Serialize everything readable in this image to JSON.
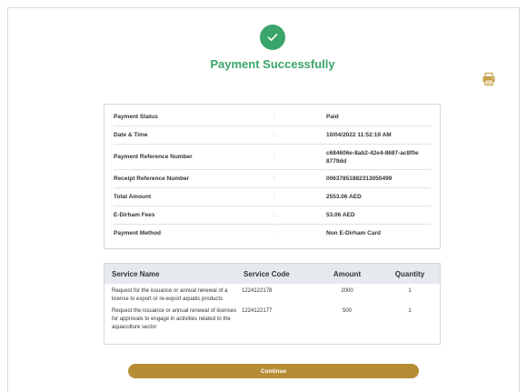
{
  "header": {
    "title": "Payment Successfully"
  },
  "icons": {
    "success": "check-circle-icon",
    "print": "printer-icon"
  },
  "colors": {
    "success": "#3aa56b",
    "button": "#b58d35",
    "table_header": "#e6eaee"
  },
  "details": [
    {
      "label": "Payment Status",
      "sep": ":",
      "value": "Paid"
    },
    {
      "label": "Date & Time",
      "sep": ":",
      "value": "10/04/2022 11:52:19 AM"
    },
    {
      "label": "Payment Reference Number",
      "sep": ":",
      "value": "c684606e-8ab2-42e4-8687-ac8f0e8779dd"
    },
    {
      "label": "Receipt Reference Number",
      "sep": ":",
      "value": "00637851882313050499"
    },
    {
      "label": "Total Amount",
      "sep": ":",
      "value": "2553.06 AED"
    },
    {
      "label": "E-Dirham Fees",
      "sep": ":",
      "value": "53.06 AED"
    },
    {
      "label": "Payment Method",
      "sep": ":",
      "value": "Non E-Dirham Card"
    }
  ],
  "services": {
    "columns": [
      "Service Name",
      "Service Code",
      "Amount",
      "Quantity"
    ],
    "rows": [
      {
        "name": "Request for the issuance or annual renewal of a license to export or re-export aquatic products",
        "code": "1224122178",
        "amount": "2000",
        "quantity": "1"
      },
      {
        "name": "Request the issuance or annual renewal of licenses for approvals to engage in activities related to the aquaculture sector",
        "code": "1224122177",
        "amount": "500",
        "quantity": "1"
      }
    ]
  },
  "actions": {
    "continue_label": "Continue"
  }
}
